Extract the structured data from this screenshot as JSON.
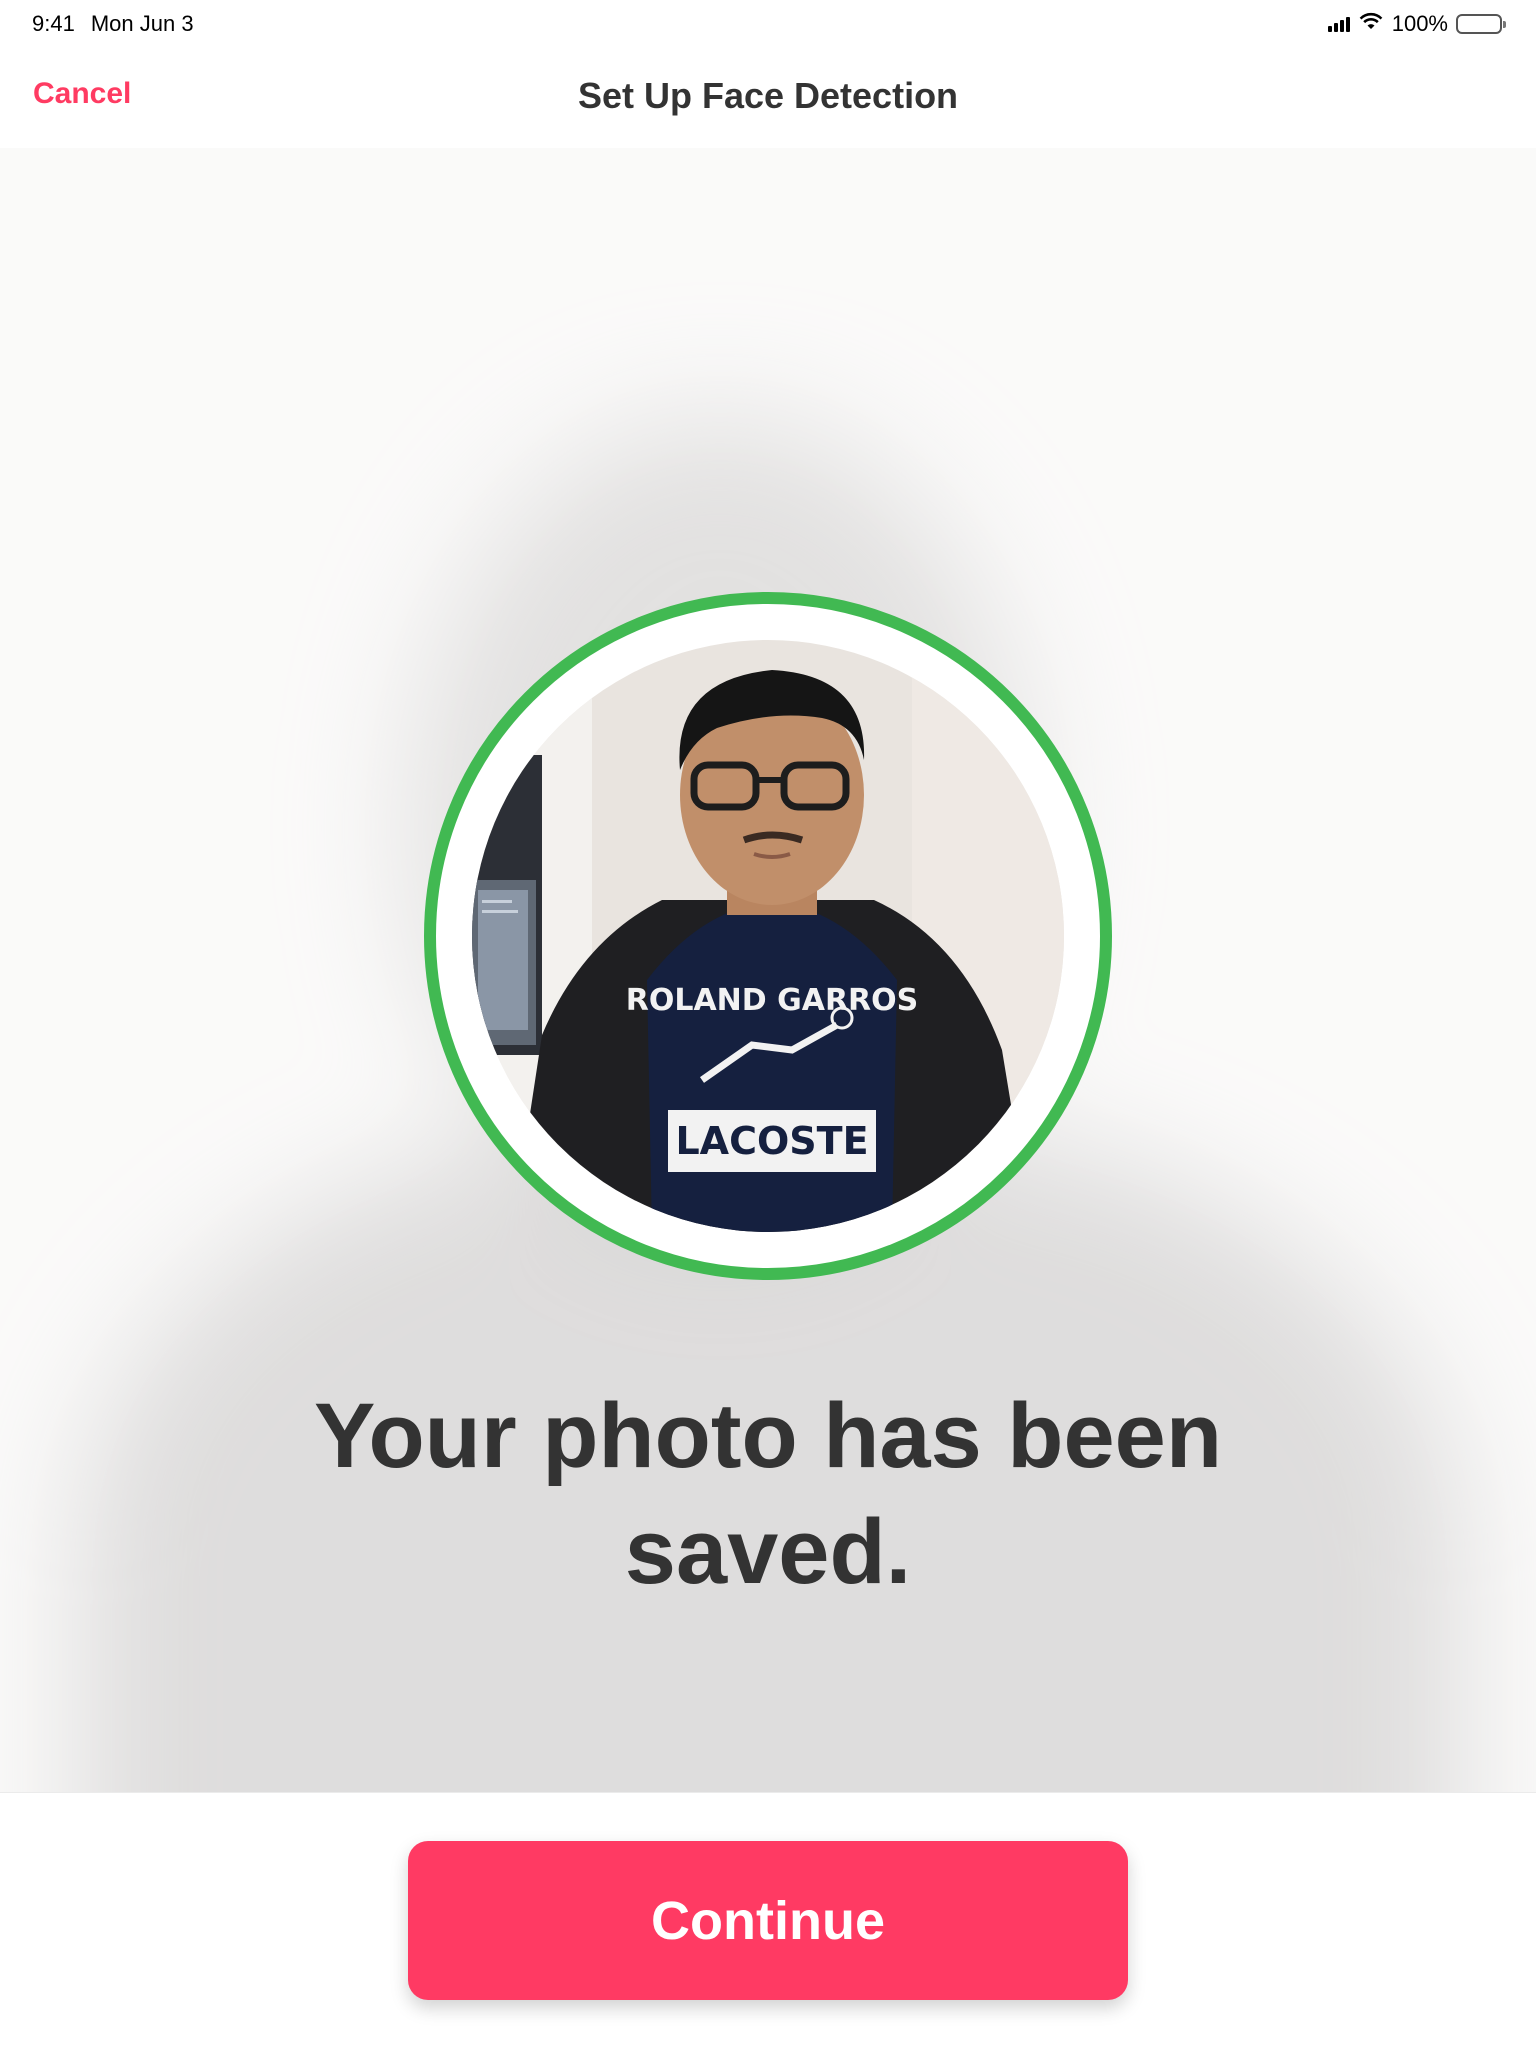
{
  "status_bar": {
    "time": "9:41",
    "date": "Mon Jun 3",
    "battery": "100%",
    "battery_level": 1.0,
    "signal_icon": "cellular-signal-icon",
    "wifi_icon": "wifi-icon",
    "battery_icon": "battery-icon"
  },
  "nav": {
    "cancel_label": "Cancel",
    "title": "Set Up Face Detection"
  },
  "photo": {
    "shirt_line1": "ROLAND GARROS",
    "shirt_line2": "LACOSTE"
  },
  "message": {
    "headline": "Your photo has been saved."
  },
  "footer": {
    "continue_label": "Continue"
  },
  "colors": {
    "accent": "#ff3a63",
    "ring": "#41b952",
    "text": "#333333"
  }
}
